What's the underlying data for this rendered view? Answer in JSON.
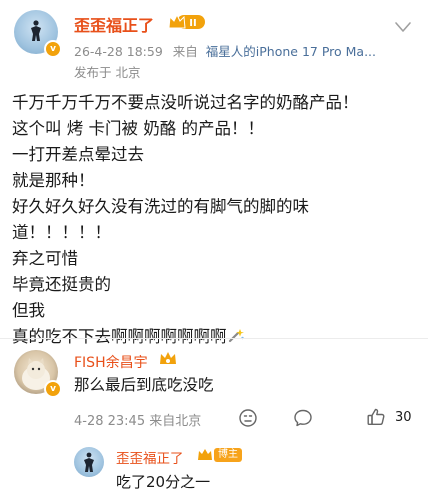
{
  "post": {
    "author": "歪歪福正了",
    "level_badge": "II",
    "date": "26-4-28 18:59",
    "source_prefix": "来自",
    "source_device": "福星人的iPhone 17 Pro Ma...",
    "location": "发布于 北京",
    "lines": [
      "千万千万千万不要点没听说过名字的奶酪产品！",
      "这个叫 烤 卡门被 奶酪 的产品！！",
      "一打开差点晕过去",
      "就是那种！",
      "好久好久好久没有洗过的有脚气的脚的味",
      "道！！！！！",
      "弃之可惜",
      "毕竟还挺贵的",
      "但我",
      "真的吃不下去啊啊啊啊啊啊啊"
    ]
  },
  "comment": {
    "author": "FISH余昌宇",
    "text": "那么最后到底吃没吃",
    "meta": "4-28 23:45 来自北京",
    "like_count": "30"
  },
  "reply": {
    "author": "歪歪福正了",
    "tag": "博主",
    "text": "吃了20分之一"
  },
  "colors": {
    "name_accent": "#e8501a",
    "badge_gold": "#f2a20c",
    "device_link": "#4a6f9a"
  }
}
